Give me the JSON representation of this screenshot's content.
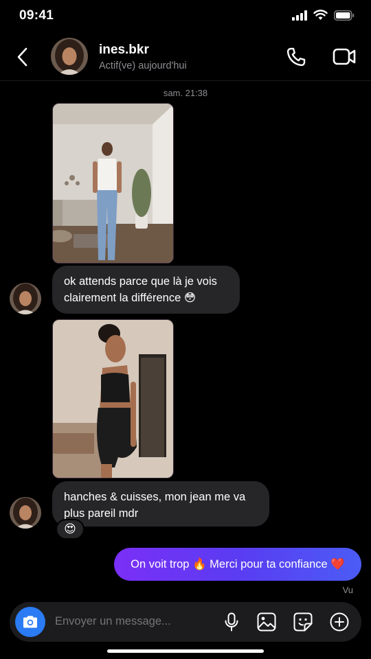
{
  "status_bar": {
    "time": "09:41"
  },
  "header": {
    "name": "ines.bkr",
    "status": "Actif(ve) aujourd'hui"
  },
  "conversation": {
    "timestamp": "sam. 21:38",
    "message1": "ok attends parce que là je vois clairement la différence 😳",
    "message2": "hanches & cuisses, mon jean me va plus pareil mdr",
    "reaction": "😍",
    "sent_message": "On voit trop 🔥 Merci pour ta confiance ❤️",
    "seen": "Vu"
  },
  "composer": {
    "placeholder": "Envoyer un message..."
  },
  "colors": {
    "accent_blue": "#2a7bf4",
    "bubble_in": "#262628",
    "bubble_out_start": "#7b2ff7",
    "bubble_out_end": "#4b5cf5"
  }
}
